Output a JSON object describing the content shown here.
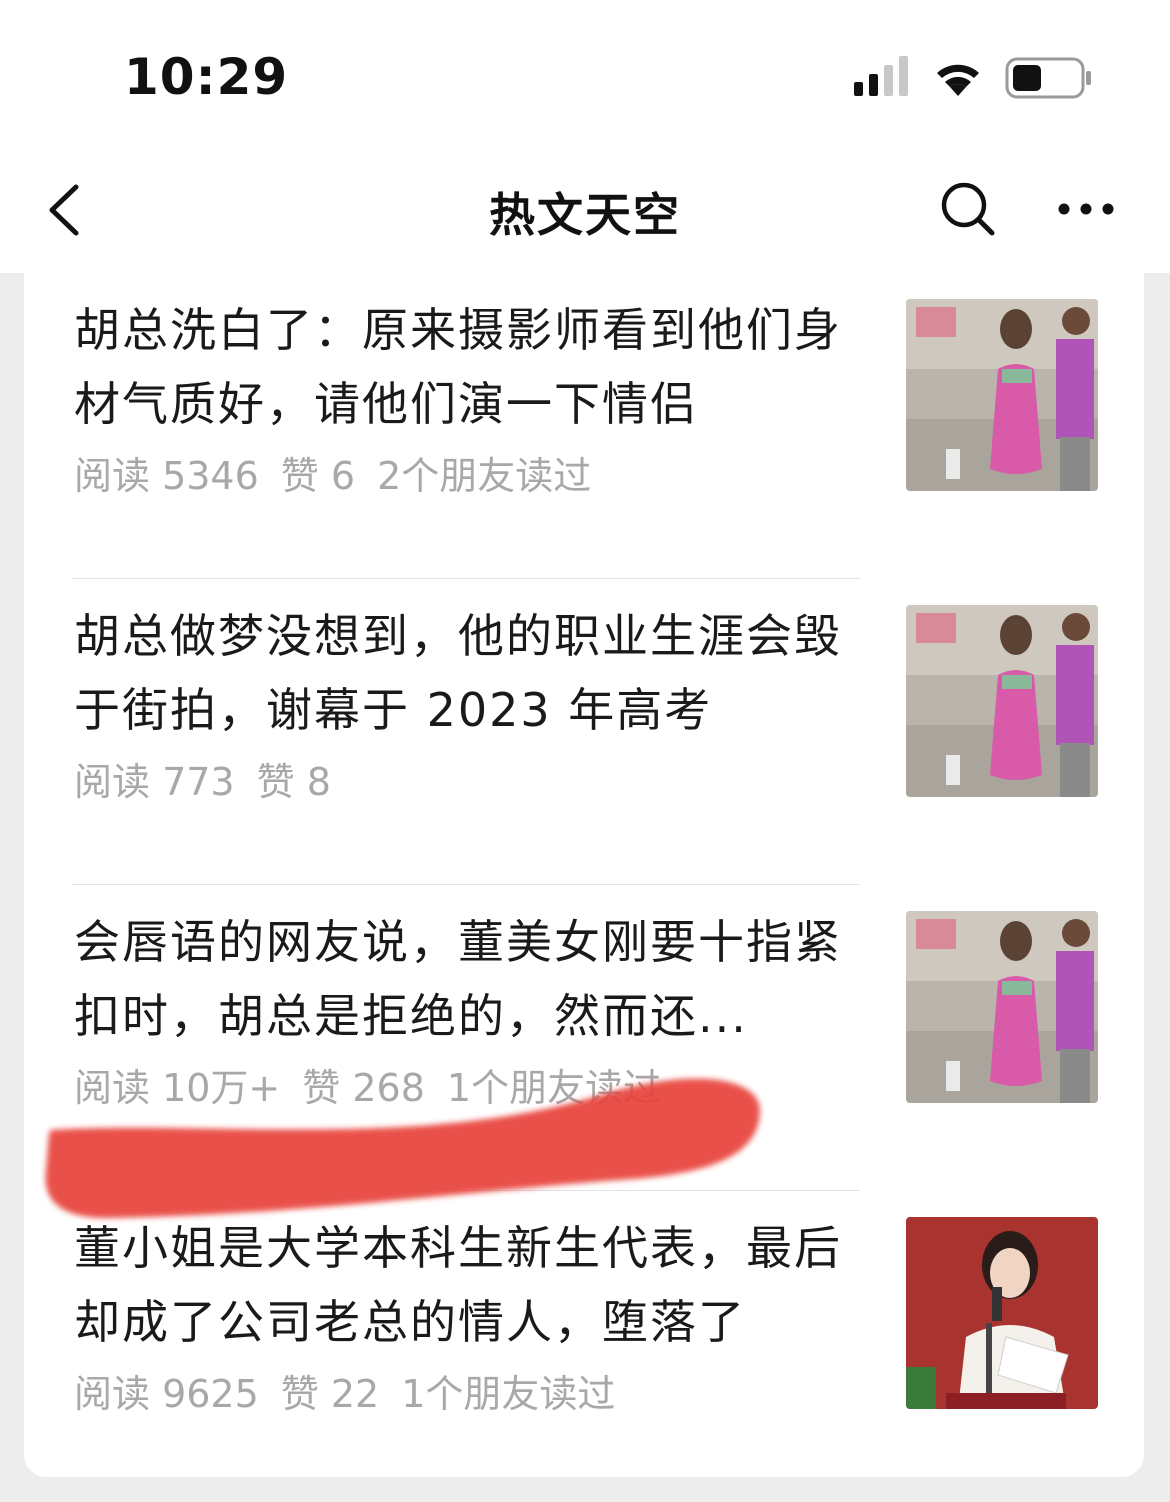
{
  "status_bar": {
    "time": "10:29",
    "icons": [
      "cellular-signal-icon",
      "wifi-icon",
      "battery-icon"
    ]
  },
  "nav": {
    "title": "热文天空",
    "back_icon": "chevron-left-icon",
    "search_icon": "search-icon",
    "more_icon": "more-dots-icon"
  },
  "articles": [
    {
      "title": "胡总洗白了：原来摄影师看到他们身材气质好，请他们演一下情侣",
      "reads": "阅读 5346",
      "likes": "赞 6",
      "friends": "2个朋友读过",
      "thumb": "street-photo-couple"
    },
    {
      "title": "胡总做梦没想到，他的职业生涯会毁于街拍，谢幕于 2023 年高考",
      "reads": "阅读 773",
      "likes": "赞 8",
      "friends": "",
      "thumb": "street-photo-couple"
    },
    {
      "title": "会唇语的网友说，董美女刚要十指紧扣时，胡总是拒绝的，然而还...",
      "reads": "阅读 10万+",
      "likes": "赞 268",
      "friends": "1个朋友读过",
      "thumb": "street-photo-couple"
    },
    {
      "title": "董小姐是大学本科生新生代表，最后却成了公司老总的情人，堕落了",
      "reads": "阅读 9625",
      "likes": "赞 22",
      "friends": "1个朋友读过",
      "thumb": "woman-speech-podium"
    }
  ],
  "colors": {
    "title_text": "#1a1a1a",
    "meta_text": "#a8a8a8",
    "background": "#ededed",
    "scribble": "#e8433a"
  }
}
